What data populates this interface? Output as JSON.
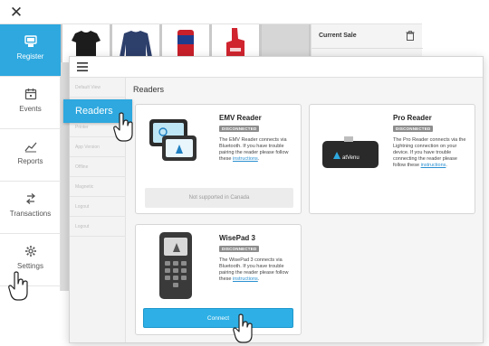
{
  "back_window": {
    "nav": [
      {
        "label": "Register",
        "icon": "register-icon",
        "active": true
      },
      {
        "label": "Events",
        "icon": "calendar-icon"
      },
      {
        "label": "Reports",
        "icon": "chart-line-icon"
      },
      {
        "label": "Transactions",
        "icon": "transfer-arrows-icon"
      },
      {
        "label": "Settings",
        "icon": "gear-icon"
      }
    ],
    "current_sale_title": "Current Sale",
    "products": [
      "black-tshirt",
      "navy-sweatshirt",
      "red-koozie",
      "red-foam-finger"
    ]
  },
  "front_window": {
    "settings_rows": [
      "Default View",
      "Printer",
      "App Version",
      "Offline",
      "Magnetic",
      "Logout",
      "Logout"
    ],
    "readers_callout": "Readers",
    "content_title": "Readers",
    "cards": {
      "emv": {
        "title": "EMV Reader",
        "badge": "DISCONNECTED",
        "desc1": "The EMV Reader connects via",
        "desc2": "Bluetooth. If you have trouble",
        "desc3": "pairing the reader please follow",
        "desc4_pre": "these ",
        "desc4_link": "instructions",
        "desc4_post": ".",
        "status": "Not supported in Canada"
      },
      "pro": {
        "title": "Pro Reader",
        "badge": "DISCONNECTED",
        "desc1": "The Pro Reader connects via the",
        "desc2": "Lightning connection on your",
        "desc3": "device. If you have trouble",
        "desc4": "connecting the reader please",
        "desc5_pre": "follow these ",
        "desc5_link": "instructions",
        "desc5_post": ".",
        "brand": "atVenu"
      },
      "wisepad": {
        "title": "WisePad 3",
        "badge": "DISCONNECTED",
        "desc1": "The WisePad 3 connects via",
        "desc2": "Bluetooth. If you have trouble",
        "desc3": "pairing the reader please follow",
        "desc4_pre": "these ",
        "desc4_link": "instructions",
        "desc4_post": ".",
        "button": "Connect"
      }
    }
  },
  "colors": {
    "accent": "#2ea8df",
    "button": "#2eb0e6",
    "badge": "#8d8d8d",
    "link": "#2a8fd0"
  }
}
